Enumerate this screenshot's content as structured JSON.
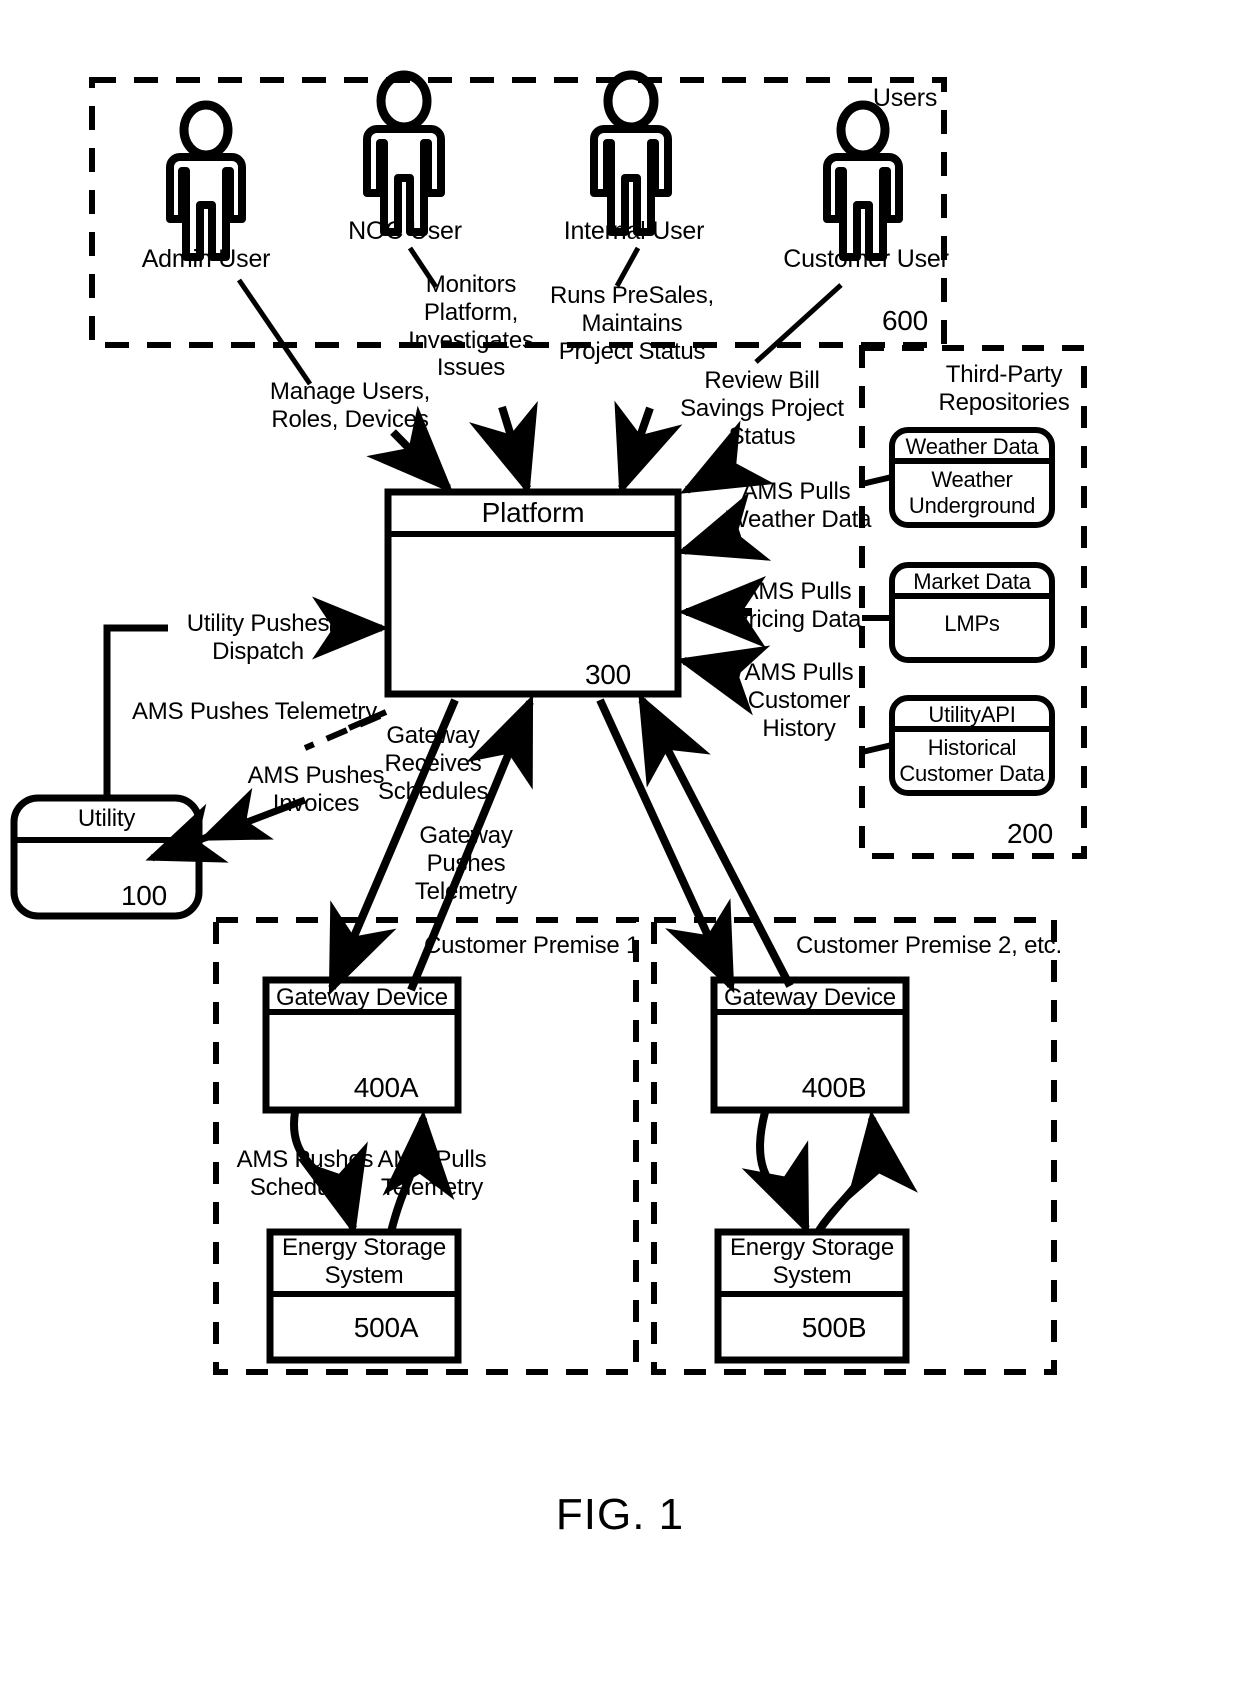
{
  "figure": {
    "caption": "FIG. 1"
  },
  "users_group": {
    "title": "Users",
    "ref": "600",
    "actors": [
      {
        "icon": "person-icon",
        "label": "Admin User"
      },
      {
        "icon": "person-icon",
        "label": "NOC User"
      },
      {
        "icon": "person-icon",
        "label": "Internal User"
      },
      {
        "icon": "person-icon",
        "label": "Customer User"
      }
    ]
  },
  "user_flows": [
    {
      "label": "Manage Users,\nRoles, Devices"
    },
    {
      "label": "Monitors\nPlatform,\nInvestigates\nIssues"
    },
    {
      "label": "Runs PreSales,\nMaintains\nProject Status"
    },
    {
      "label": "Review Bill\nSavings Project\nStatus"
    }
  ],
  "platform": {
    "title": "Platform",
    "ref": "300"
  },
  "third_party": {
    "title": "Third-Party\nRepositories",
    "ref": "200",
    "repositories": [
      {
        "header": "Weather Data",
        "body": "Weather\nUnderground"
      },
      {
        "header": "Market Data",
        "body": "LMPs"
      },
      {
        "header": "UtilityAPI",
        "body": "Historical\nCustomer Data"
      }
    ],
    "pull_labels": [
      "AMS Pulls\nWeather Data",
      "AMS Pulls\nPricing Data",
      "AMS Pulls\nCustomer\nHistory"
    ]
  },
  "utility": {
    "title": "Utility",
    "ref": "100",
    "push_dispatch": "Utility Pushes\nDispatch",
    "push_telemetry": "AMS Pushes Telemetry",
    "push_invoices": "AMS Pushes\nInvoices"
  },
  "gateway_flows": {
    "receives_schedules": "Gateway\nReceives\nSchedules",
    "pushes_telemetry": "Gateway\nPushes\nTelemetry"
  },
  "premises": [
    {
      "title": "Customer Premise 1",
      "gateway": {
        "header": "Gateway Device",
        "ref": "400A"
      },
      "storage": {
        "header": "Energy Storage\nSystem",
        "ref": "500A"
      },
      "flow_push": "AMS Pushes\nSchedules",
      "flow_pull": "AMS Pulls\nTelemetry"
    },
    {
      "title": "Customer Premise 2, etc.",
      "gateway": {
        "header": "Gateway Device",
        "ref": "400B"
      },
      "storage": {
        "header": "Energy Storage\nSystem",
        "ref": "500B"
      },
      "flow_push": "",
      "flow_pull": ""
    }
  ],
  "colors": {
    "stroke": "#000000",
    "fill": "#ffffff"
  }
}
